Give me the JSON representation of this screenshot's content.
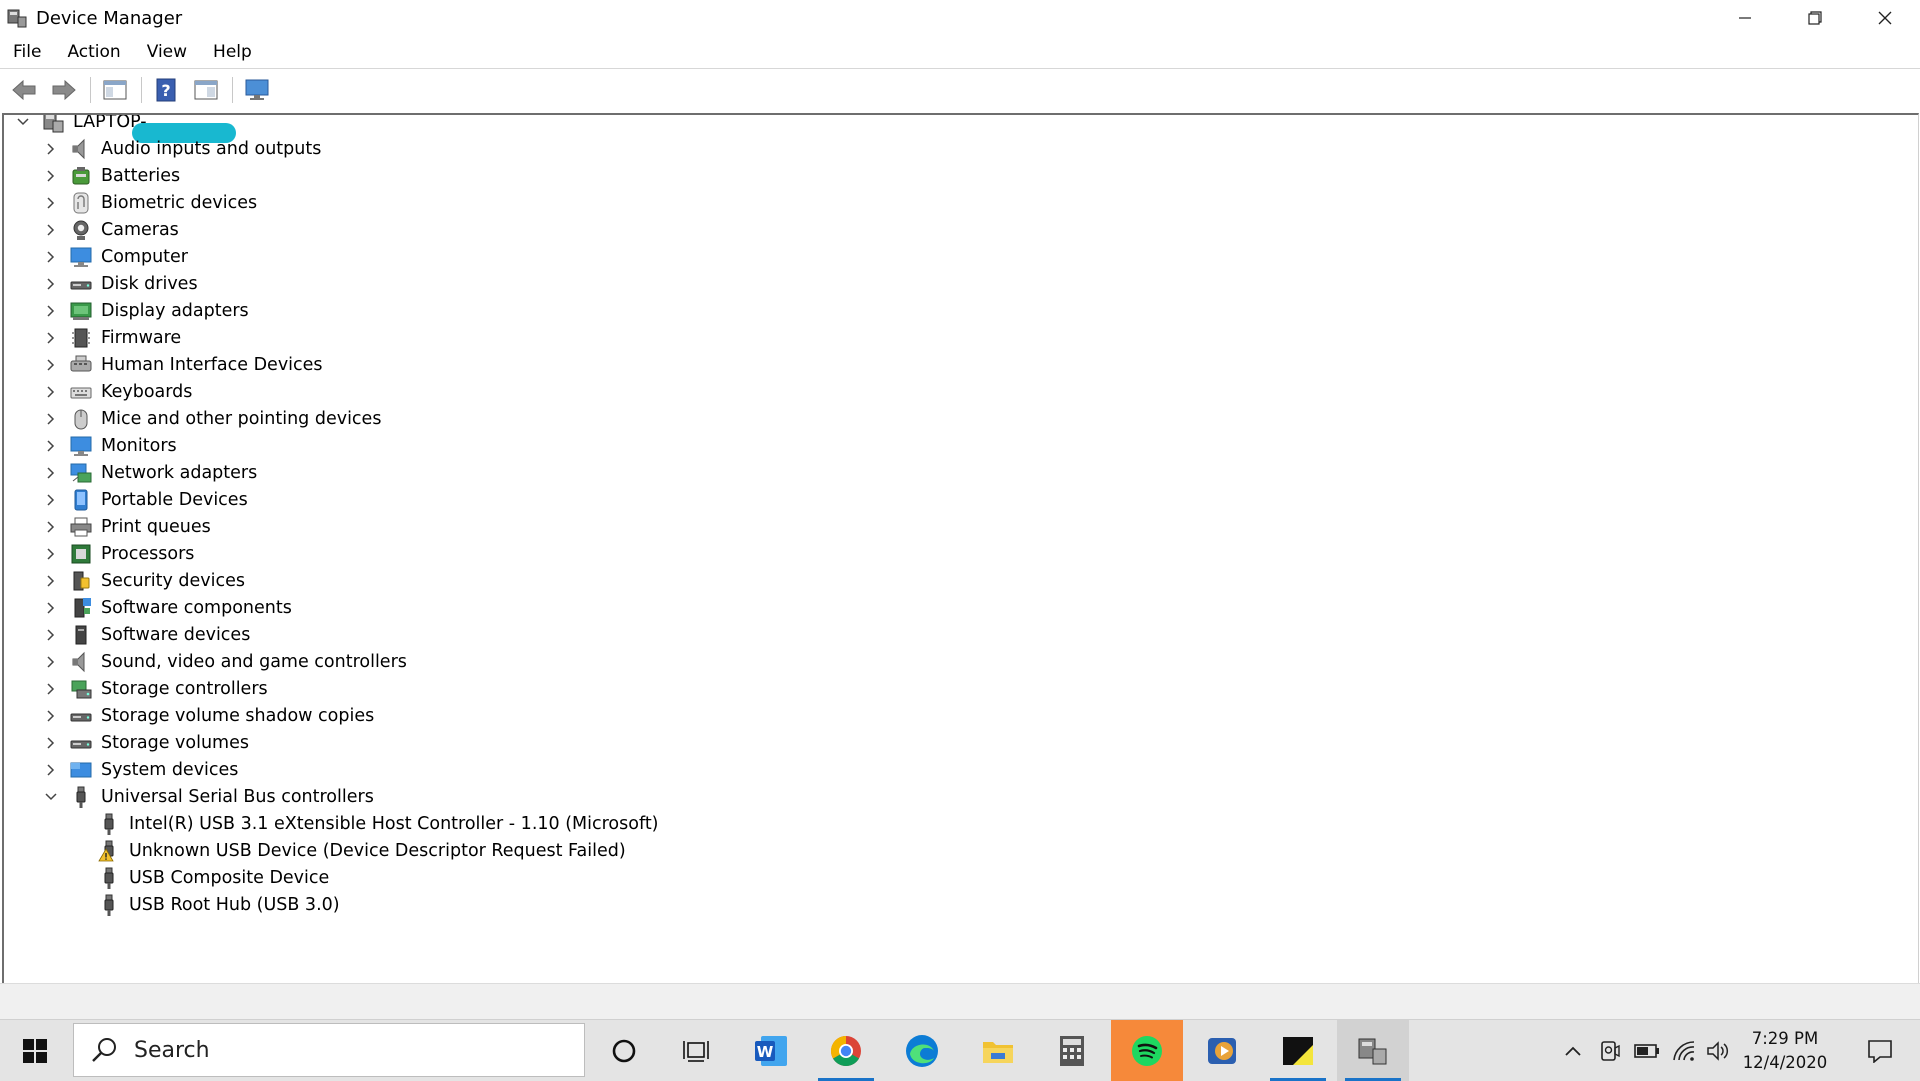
{
  "window": {
    "title": "Device Manager"
  },
  "menu": [
    "File",
    "Action",
    "View",
    "Help"
  ],
  "tree": {
    "root": {
      "label": "LAPTOP-"
    },
    "categories": [
      {
        "label": "Audio inputs and outputs",
        "icon": "speaker-icon"
      },
      {
        "label": "Batteries",
        "icon": "battery-icon"
      },
      {
        "label": "Biometric devices",
        "icon": "fingerprint-icon"
      },
      {
        "label": "Cameras",
        "icon": "camera-icon"
      },
      {
        "label": "Computer",
        "icon": "computer-icon"
      },
      {
        "label": "Disk drives",
        "icon": "disk-drive-icon"
      },
      {
        "label": "Display adapters",
        "icon": "display-adapter-icon"
      },
      {
        "label": "Firmware",
        "icon": "firmware-icon"
      },
      {
        "label": "Human Interface Devices",
        "icon": "hid-icon"
      },
      {
        "label": "Keyboards",
        "icon": "keyboard-icon"
      },
      {
        "label": "Mice and other pointing devices",
        "icon": "mouse-icon"
      },
      {
        "label": "Monitors",
        "icon": "monitor-icon"
      },
      {
        "label": "Network adapters",
        "icon": "network-adapter-icon"
      },
      {
        "label": "Portable Devices",
        "icon": "portable-device-icon"
      },
      {
        "label": "Print queues",
        "icon": "printer-icon"
      },
      {
        "label": "Processors",
        "icon": "processor-icon"
      },
      {
        "label": "Security devices",
        "icon": "security-device-icon"
      },
      {
        "label": "Software components",
        "icon": "software-component-icon"
      },
      {
        "label": "Software devices",
        "icon": "software-device-icon"
      },
      {
        "label": "Sound, video and game controllers",
        "icon": "speaker-icon"
      },
      {
        "label": "Storage controllers",
        "icon": "storage-controller-icon"
      },
      {
        "label": "Storage volume shadow copies",
        "icon": "disk-drive-icon"
      },
      {
        "label": "Storage volumes",
        "icon": "disk-drive-icon"
      },
      {
        "label": "System devices",
        "icon": "system-devices-icon"
      },
      {
        "label": "Universal Serial Bus controllers",
        "icon": "usb-icon"
      }
    ],
    "usb_children": [
      {
        "label": "Intel(R) USB 3.1 eXtensible Host Controller - 1.10 (Microsoft)",
        "icon": "usb-icon"
      },
      {
        "label": "Unknown USB Device (Device Descriptor Request Failed)",
        "icon": "warning-icon"
      },
      {
        "label": "USB Composite Device",
        "icon": "usb-icon"
      },
      {
        "label": "USB Root Hub (USB 3.0)",
        "icon": "usb-icon"
      }
    ]
  },
  "taskbar": {
    "search_placeholder": "Search",
    "clock_time": "7:29 PM",
    "clock_date": "12/4/2020"
  },
  "colors": {
    "accent": "#1a73c8",
    "spotify": "#f6893a",
    "redaction": "#18b8d0"
  }
}
